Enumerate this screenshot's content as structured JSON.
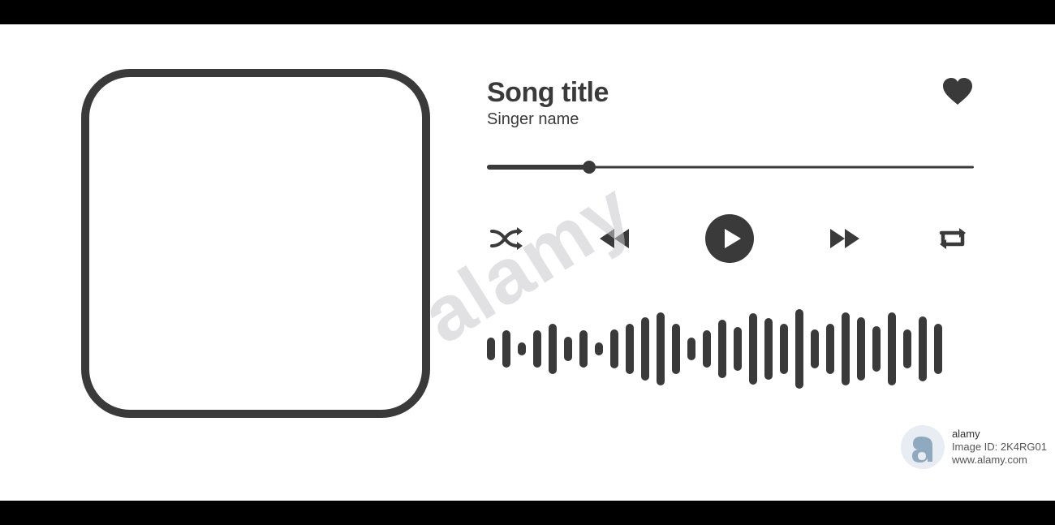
{
  "watermark": {
    "diagonal_text": "alamy",
    "logo_letter": "a",
    "line1": "alamy",
    "line2_prefix": "Image ID: ",
    "image_id": "2K4RG01",
    "site": "www.alamy.com"
  },
  "player": {
    "song_title": "Song title",
    "singer_name": "Singer name",
    "icons": {
      "favorite": "heart-icon",
      "shuffle": "shuffle-icon",
      "previous": "rewind-icon",
      "play": "play-icon",
      "next": "forward-icon",
      "repeat": "repeat-icon"
    },
    "colors": {
      "primary": "#3a3a3a"
    },
    "progress": {
      "percent": 21
    },
    "waveform_heights": [
      28,
      46,
      16,
      46,
      62,
      30,
      46,
      16,
      48,
      62,
      78,
      90,
      62,
      28,
      46,
      72,
      54,
      88,
      76,
      62,
      98,
      48,
      62,
      90,
      78,
      56,
      90,
      48,
      80,
      62
    ]
  }
}
